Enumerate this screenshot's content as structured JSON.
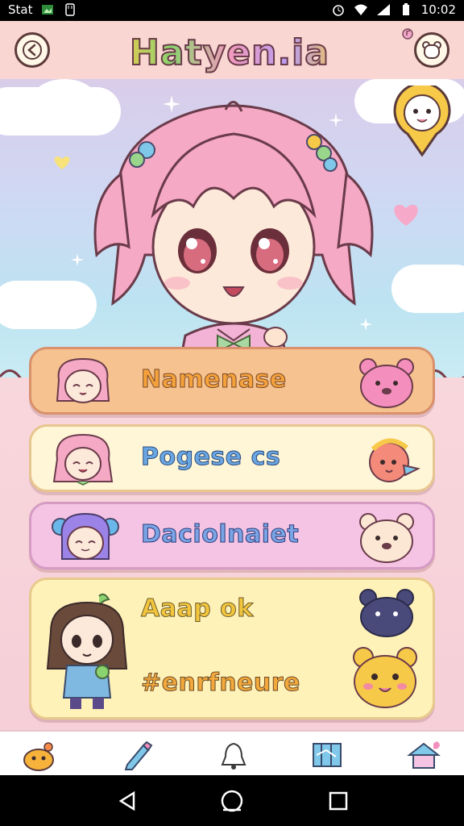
{
  "status_bar": {
    "left_text": "Stat",
    "time": "10:02"
  },
  "header": {
    "logo_text": "Hatyen.ia",
    "trademark": "TM"
  },
  "menu": [
    {
      "label": "Namenase",
      "color": "#f6c28f",
      "border": "#d8916b",
      "text_color": "#f5a23c"
    },
    {
      "label": "Pogese cs",
      "color": "#fff6d8",
      "border": "#e7c58e",
      "text_color": "#6aa6e2"
    },
    {
      "label": "Daciolnaiet",
      "color": "#f5c4e4",
      "border": "#d59bc4",
      "text_color": "#7aa4e4"
    },
    {
      "label_top": "Aaap ok",
      "label_bottom": "#enrfneure",
      "color": "#fff2b8",
      "border": "#e8c98c",
      "text_color_top": "#f2c53d",
      "text_color_bottom": "#f2a83a"
    }
  ],
  "nav": {
    "items": [
      "home-icon",
      "pencil-icon",
      "bell-icon",
      "map-icon",
      "house-icon"
    ]
  },
  "system_nav": {
    "items": [
      "back-icon",
      "home-icon",
      "recents-icon"
    ]
  }
}
